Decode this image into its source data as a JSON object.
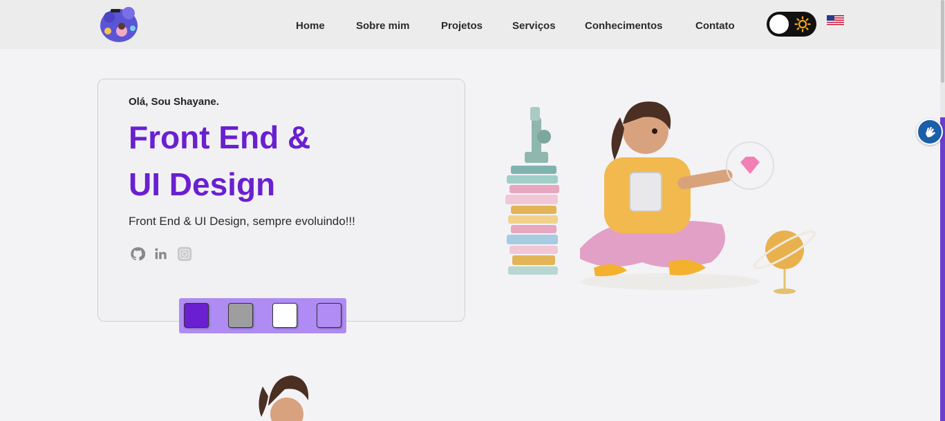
{
  "nav": {
    "items": [
      {
        "label": "Home"
      },
      {
        "label": "Sobre mim"
      },
      {
        "label": "Projetos"
      },
      {
        "label": "Serviços"
      },
      {
        "label": "Conhecimentos"
      },
      {
        "label": "Contato"
      }
    ],
    "theme_toggle": {
      "state": "light",
      "icon": "sun-icon"
    },
    "language_flag": "us-flag-icon"
  },
  "hero": {
    "greeting": "Olá, Sou Shayane.",
    "title_line1": "Front End &",
    "title_line2": "UI Design",
    "subtitle": "Front End & UI Design, sempre evoluindo!!!",
    "social": [
      "github-icon",
      "linkedin-icon",
      "instagram-icon"
    ]
  },
  "palette": {
    "colors": [
      "#6a1fd0",
      "#9e9e9e",
      "#ffffff",
      "#b08cf3"
    ]
  },
  "colors": {
    "accent": "#6a1fd0",
    "navbar_bg": "#ececec",
    "page_bg": "#f3f3f6"
  }
}
